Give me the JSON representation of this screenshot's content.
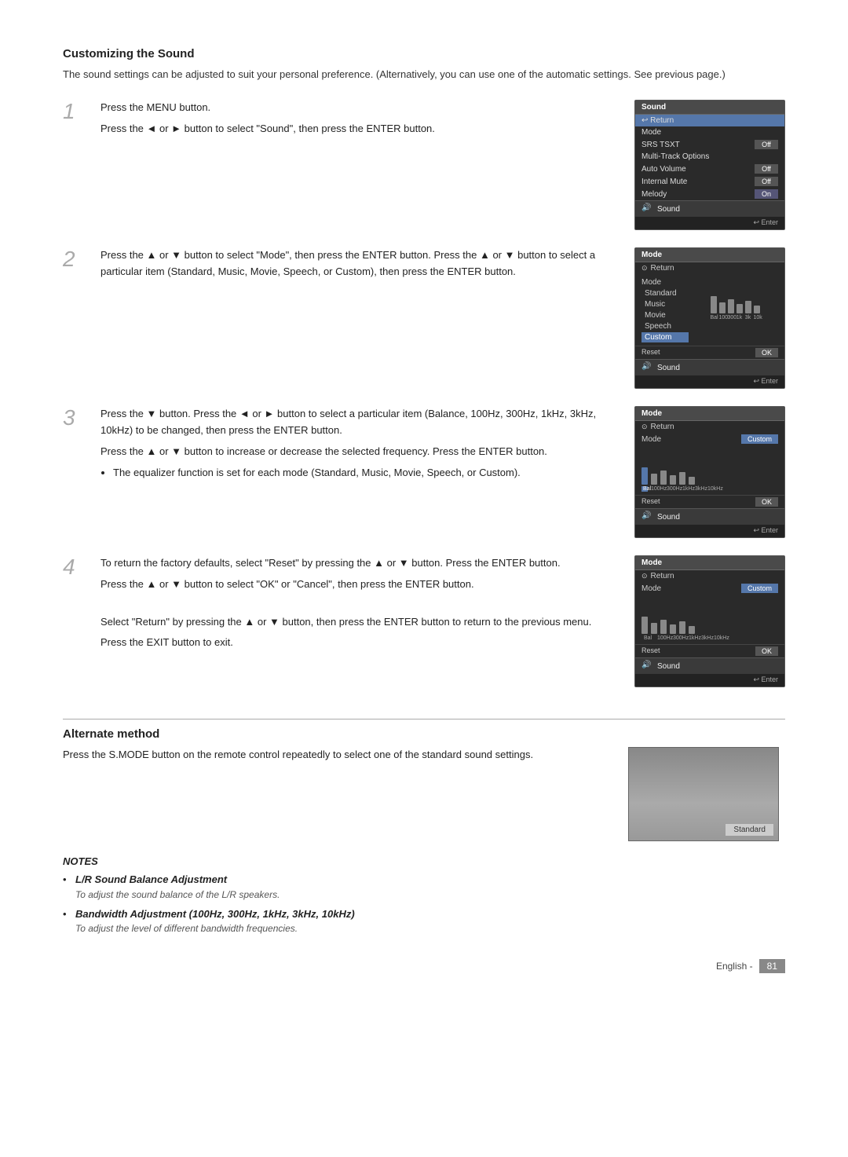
{
  "page": {
    "title": "Customizing the Sound",
    "intro": "The sound settings can be adjusted to suit your personal preference. (Alternatively, you can use one of the automatic settings. See previous page.)"
  },
  "steps": [
    {
      "number": "1",
      "lines": [
        "Press the MENU button.",
        "Press the ◄ or ► button to select \"Sound\", then press the ENTER button."
      ]
    },
    {
      "number": "2",
      "lines": [
        "Press the ▲ or ▼ button to select \"Mode\", then press the ENTER button. Press the ▲ or ▼ button to select a particular item (Standard, Music, Movie, Speech, or Custom), then press the ENTER button."
      ]
    },
    {
      "number": "3",
      "lines": [
        "Press the ▼ button. Press the ◄ or ► button to select a particular item (Balance, 100Hz, 300Hz, 1kHz, 3kHz, 10kHz) to be changed, then press the ENTER button.",
        "Press the ▲ or ▼ button to increase or decrease the selected frequency. Press the ENTER button."
      ],
      "bullet": "The equalizer function is set for each mode (Standard, Music, Movie, Speech, or Custom)."
    },
    {
      "number": "4",
      "lines": [
        "To return the factory defaults, select \"Reset\" by pressing the ▲ or ▼ button. Press the ENTER button.",
        "Press the ▲ or ▼ button to select \"OK\" or \"Cancel\", then press the ENTER button.",
        "Select \"Return\" by pressing the ▲ or ▼ button, then press the ENTER button to return to the previous menu.",
        "Press the EXIT button to exit."
      ]
    }
  ],
  "menu1": {
    "title": "Sound",
    "items": [
      {
        "label": "Return",
        "value": "",
        "type": "return",
        "highlighted": true
      },
      {
        "label": "Mode",
        "value": "",
        "type": "plain"
      },
      {
        "label": "SRS TSXT",
        "value": "Off",
        "type": "value"
      },
      {
        "label": "Multi-Track Options",
        "value": "",
        "type": "plain"
      },
      {
        "label": "Auto Volume",
        "value": "Off",
        "type": "value"
      },
      {
        "label": "Internal Mute",
        "value": "Off",
        "type": "value"
      },
      {
        "label": "Melody",
        "value": "On",
        "type": "value"
      }
    ],
    "badge": "Sound",
    "enter": "Enter"
  },
  "menu2": {
    "title": "Mode",
    "return": "Return",
    "modeLabel": "Mode",
    "options": [
      "Standard",
      "Music",
      "Movie",
      "Speech",
      "Custom"
    ],
    "selected": "Custom",
    "eqLabels": [
      "Balance",
      "100Hz",
      "300Hz",
      "1kHz",
      "3kHz",
      "10kHz"
    ],
    "eqBars": [
      40,
      28,
      32,
      22,
      30,
      18
    ],
    "badge": "Sound",
    "enter": "Enter",
    "resetLabel": "Reset",
    "okLabel": "OK"
  },
  "menu3": {
    "title": "Mode",
    "return": "Return",
    "modeLabel": "Mode",
    "modeValue": "Custom",
    "eqLabels": [
      "Balance",
      "100Hz",
      "300Hz",
      "1kHz",
      "3kHz",
      "10kHz"
    ],
    "eqBars": [
      40,
      28,
      32,
      22,
      30,
      18
    ],
    "balanceSelected": true,
    "badge": "Sound",
    "enter": "Enter",
    "resetLabel": "Reset",
    "okLabel": "OK"
  },
  "menu4": {
    "title": "Mode",
    "return": "Return",
    "modeLabel": "Mode",
    "modeValue": "Custom",
    "eqLabels": [
      "Balance",
      "100Hz",
      "300Hz",
      "1kHz",
      "3kHz",
      "10kHz"
    ],
    "eqBars": [
      40,
      28,
      32,
      22,
      30,
      18
    ],
    "badge": "Sound",
    "enter": "Enter",
    "resetLabel": "Reset",
    "okLabel": "OK"
  },
  "alt_method": {
    "title": "Alternate method",
    "text": "Press the S.MODE button on the remote control repeatedly to select one of the standard sound settings.",
    "screen_badge": "Standard"
  },
  "notes": {
    "title": "NOTES",
    "items": [
      {
        "title": "L/R Sound Balance Adjustment",
        "body": "To adjust the sound balance of the L/R speakers."
      },
      {
        "title": "Bandwidth Adjustment (100Hz, 300Hz, 1kHz, 3kHz, 10kHz)",
        "body": "To adjust the level of different bandwidth frequencies."
      }
    ]
  },
  "footer": {
    "lang": "English -",
    "page": "81"
  }
}
